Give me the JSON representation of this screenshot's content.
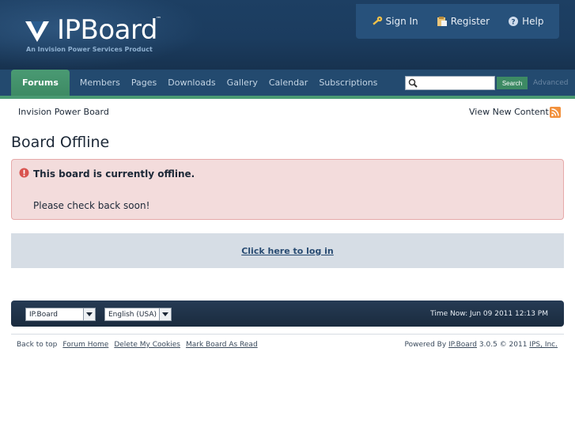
{
  "header": {
    "logo_text": "IPBoard",
    "logo_tm": "™",
    "tagline": "An Invision Power Services Product",
    "user_links": [
      {
        "label": "Sign In",
        "icon": "key-icon"
      },
      {
        "label": "Register",
        "icon": "clipboard-icon"
      },
      {
        "label": "Help",
        "icon": "help-icon"
      }
    ]
  },
  "nav": {
    "tabs": [
      "Forums",
      "Members",
      "Pages",
      "Downloads",
      "Gallery",
      "Calendar",
      "Subscriptions"
    ],
    "active_tab": "Forums",
    "search": {
      "value": "",
      "placeholder": "",
      "button_label": "Search",
      "advanced_label": "Advanced"
    }
  },
  "breadcrumb": {
    "home": "Invision Power Board",
    "view_new": "View New Content"
  },
  "main": {
    "title": "Board Offline",
    "error_heading": "This board is currently offline.",
    "error_message": "Please check back soon!",
    "login_link": "Click here to log in"
  },
  "footer": {
    "skin_select": "IP.Board",
    "lang_select": "English (USA)",
    "time_now": "Time Now: Jun 09 2011 12:13 PM",
    "links": [
      "Back to top",
      "Forum Home",
      "Delete My Cookies",
      "Mark Board As Read"
    ],
    "powered_prefix": "Powered By",
    "powered_product": "IP.Board",
    "powered_version": "3.0.5 © 2011",
    "powered_company": "IPS, Inc."
  },
  "colors": {
    "header_bg": "#1b3c5f",
    "nav_bg": "#234a6f",
    "accent_green": "#4a9a73",
    "error_bg": "#f3dcdc",
    "login_bg": "#d6dde5"
  }
}
